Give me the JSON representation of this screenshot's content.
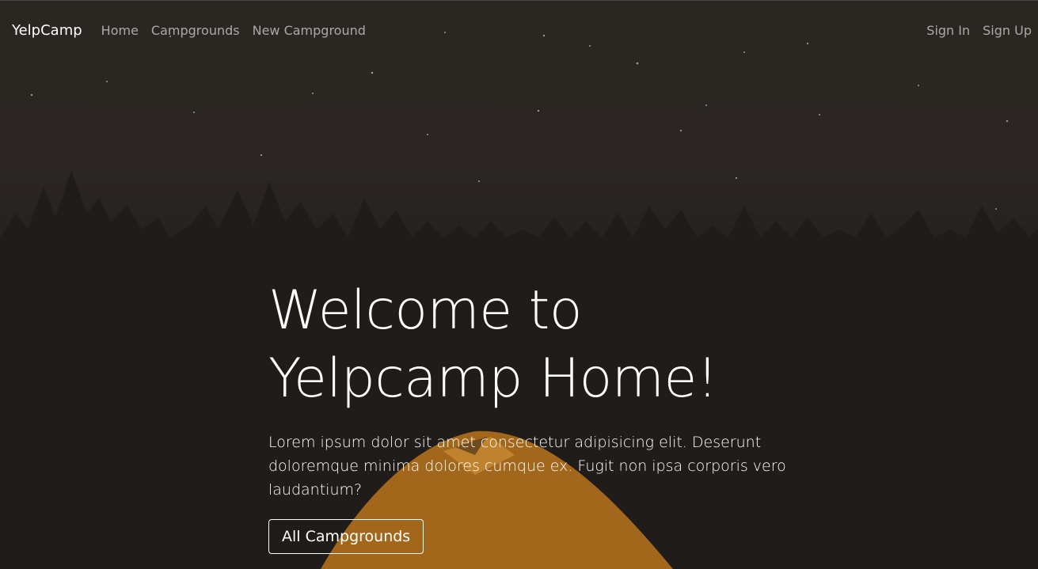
{
  "navbar": {
    "brand": "YelpCamp",
    "links": [
      "Home",
      "Campgrounds",
      "New Campground"
    ],
    "auth": [
      "Sign In",
      "Sign Up"
    ]
  },
  "hero": {
    "title_line1": "Welcome to",
    "title_line2": "Yelpcamp Home!",
    "lead": "Lorem ipsum dolor sit amet consectetur adipisicing elit. Deserunt doloremque minima dolores cumque ex. Fugit non ipsa corporis vero laudantium?",
    "button_label": "All Campgrounds"
  },
  "colors": {
    "overlay": "#1c1a18",
    "tent": "#c27d1e",
    "text": "#ffffff"
  }
}
